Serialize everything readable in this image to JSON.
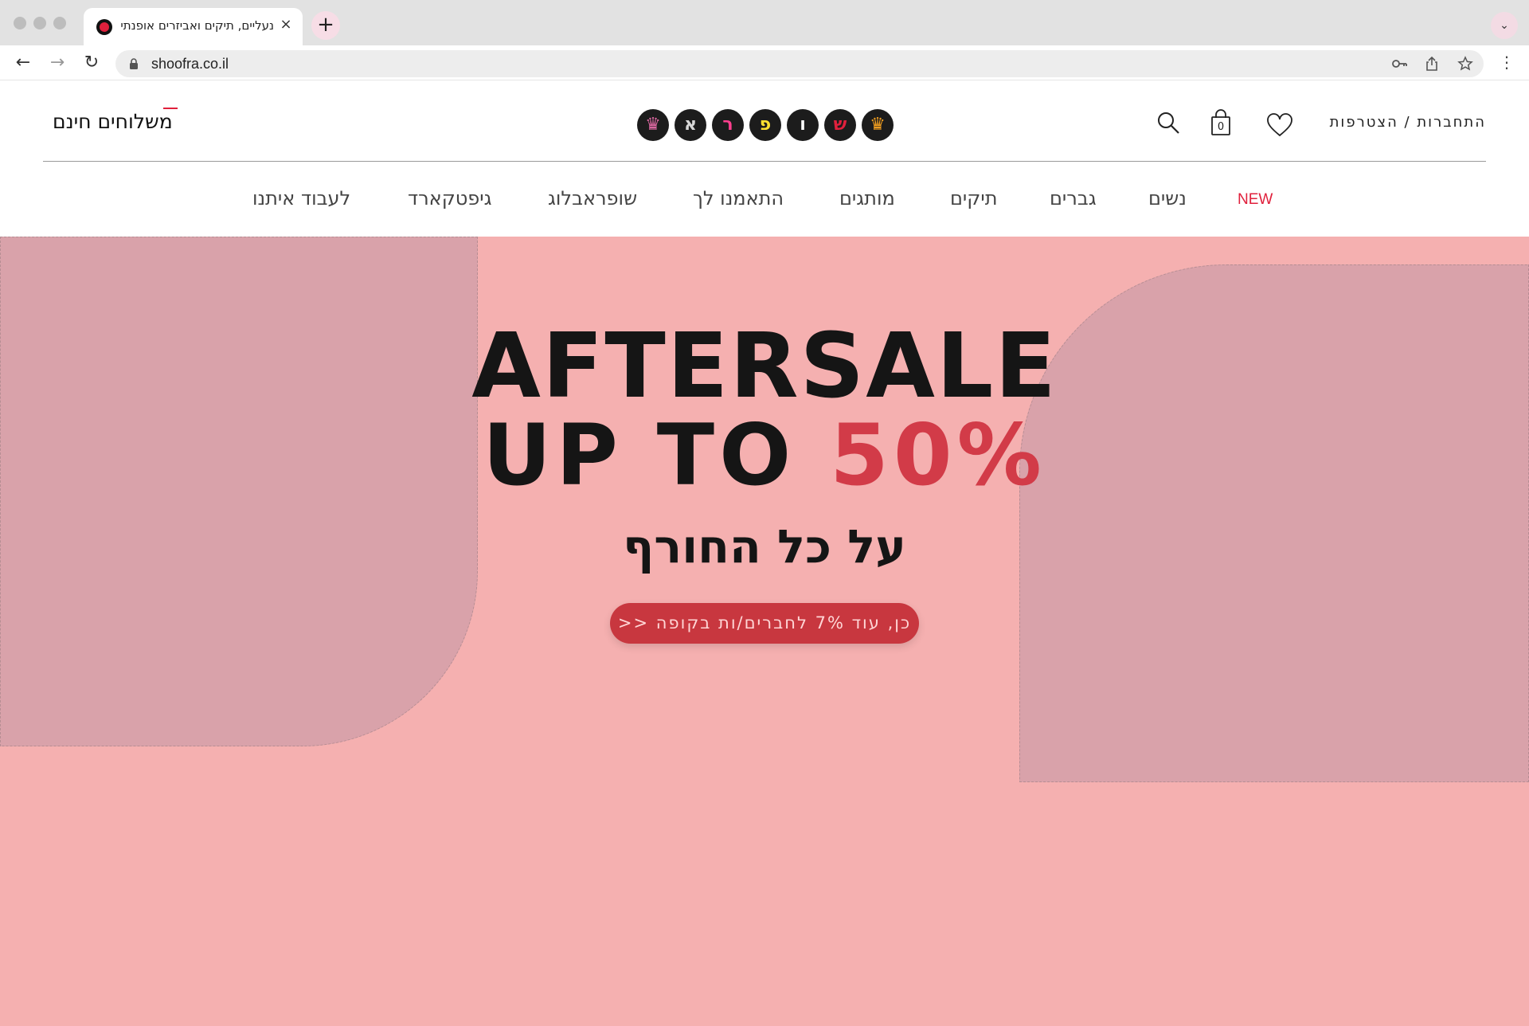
{
  "browser": {
    "tab_title": "נעליים, תיקים ואביזרים אופנתיים - נעליים אונליין במשלוח חינם עד הבית",
    "tab_close": "×",
    "new_tab": "+",
    "tab_menu": "⌄",
    "url": "shoofra.co.il",
    "back": "←",
    "forward": "→",
    "reload": "↻",
    "menu": "⋮"
  },
  "header": {
    "free_shipping": "משלוחים חינם",
    "logo_letters": [
      "",
      "ש",
      "ו",
      "פ",
      "ר",
      "א",
      ""
    ],
    "auth": "התחברות / הצטרפות",
    "cart_count": "0"
  },
  "nav": {
    "items": [
      "NEW",
      "נשים",
      "גברים",
      "תיקים",
      "מותגים",
      "התאמנו לך",
      "שופראבלוג",
      "גיפטקארד",
      "לעבוד איתנו"
    ]
  },
  "hero": {
    "line1": "AFTERSALE",
    "line2_prefix": "UP TO ",
    "line2_accent": "50%",
    "hebrew": "על כל החורף",
    "cta": "כן, עוד 7% לחברים/ות בקופה <<",
    "background_color": "#f5b0b0",
    "accent_color": "#d23b48"
  }
}
